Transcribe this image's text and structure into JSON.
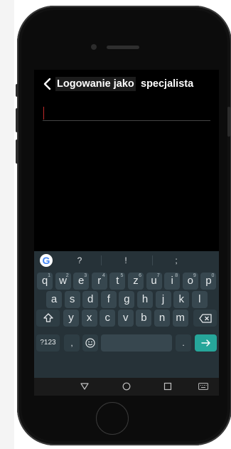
{
  "app": {
    "title_highlight": "Logowanie jako",
    "title_rest": "specjalista",
    "back_icon": "chevron-left-icon"
  },
  "input": {
    "value": ""
  },
  "keyboard": {
    "suggestions": [
      "?",
      "!",
      ";"
    ],
    "row1": [
      {
        "k": "q",
        "h": "1"
      },
      {
        "k": "w",
        "h": "2"
      },
      {
        "k": "e",
        "h": "3"
      },
      {
        "k": "r",
        "h": "4"
      },
      {
        "k": "t",
        "h": "5"
      },
      {
        "k": "z",
        "h": "6"
      },
      {
        "k": "u",
        "h": "7"
      },
      {
        "k": "i",
        "h": "8"
      },
      {
        "k": "o",
        "h": "9"
      },
      {
        "k": "p",
        "h": "0"
      }
    ],
    "row2": [
      "a",
      "s",
      "d",
      "f",
      "g",
      "h",
      "j",
      "k",
      "l"
    ],
    "row3": [
      "y",
      "x",
      "c",
      "v",
      "b",
      "n",
      "m"
    ],
    "symbols_label": "?123",
    "comma": ",",
    "period": ".",
    "emoji_icon": "emoji-icon",
    "shift_icon": "shift-icon",
    "backspace_icon": "backspace-icon",
    "enter_icon": "enter-arrow-icon"
  },
  "navbar": {
    "back_icon": "nav-back-triangle-icon",
    "home_icon": "nav-home-circle-icon",
    "recents_icon": "nav-recents-square-icon",
    "keyboard_icon": "keyboard-switch-icon"
  },
  "colors": {
    "keyboard_bg": "#263238",
    "key_bg": "#37474f",
    "enter_key": "#26a69a",
    "caret": "#c02a2a"
  }
}
